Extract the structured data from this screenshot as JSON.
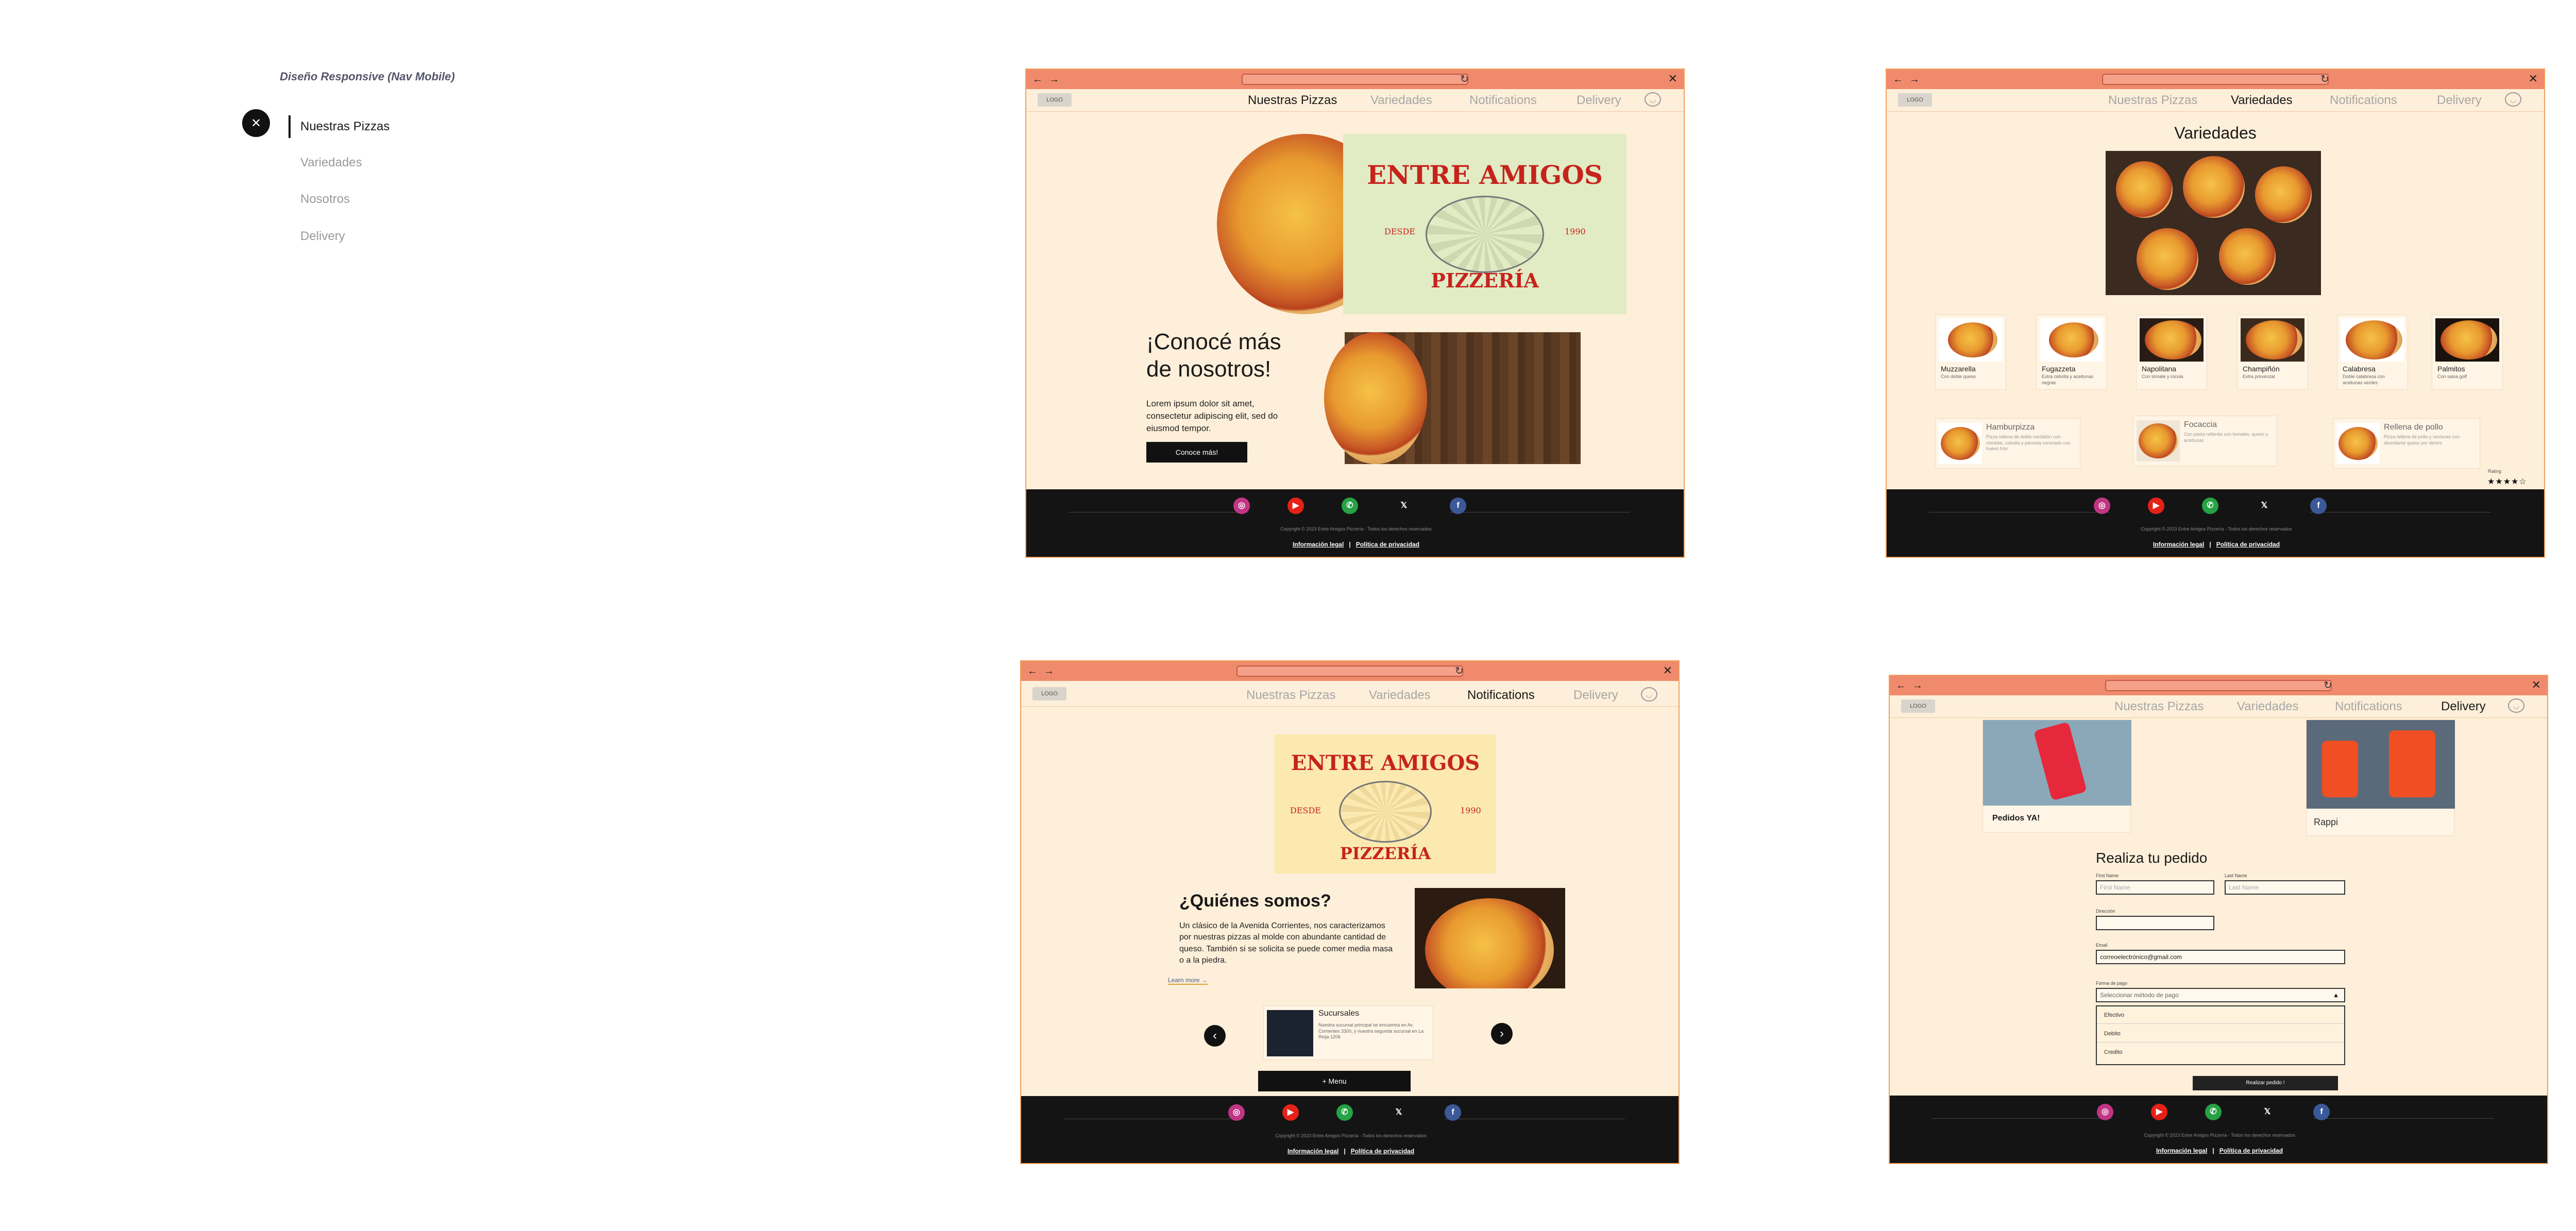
{
  "mobile_nav": {
    "heading": "Diseño Responsive (Nav Mobile)",
    "close_glyph": "✕",
    "items": [
      {
        "label": "Nuestras Pizzas"
      },
      {
        "label": "Variedades"
      },
      {
        "label": "Nosotros"
      },
      {
        "label": "Delivery"
      }
    ]
  },
  "browser": {
    "back": "←",
    "forward": "→",
    "reload": "↻",
    "close": "✕",
    "logo_label": "LOGO"
  },
  "nav": {
    "links": [
      "Nuestras Pizzas",
      "Variedades",
      "Notifications",
      "Delivery"
    ]
  },
  "footer": {
    "copyright": "Copyright © 2023 Entre Amigos Pizzería - Todos los derechos reservados",
    "legal": "Información legal",
    "separator": "|",
    "privacy": "Política de privacidad",
    "socials": [
      {
        "icon": "instagram-icon",
        "glyph": "◎",
        "color": "#c13584"
      },
      {
        "icon": "youtube-icon",
        "glyph": "▶",
        "color": "#e62117"
      },
      {
        "icon": "whatsapp-icon",
        "glyph": "✆",
        "color": "#25a244"
      },
      {
        "icon": "x-icon",
        "glyph": "𝕏",
        "color": "#141414"
      },
      {
        "icon": "facebook-icon",
        "glyph": "f",
        "color": "#3b5998"
      }
    ]
  },
  "brand": {
    "title": "ENTRE AMIGOS",
    "desde": "DESDE",
    "year": "1990",
    "pizzeria": "PIZZERÍA"
  },
  "screen1": {
    "about_title_1": "¡Conocé más",
    "about_title_2": "de nosotros!",
    "about_text": "Lorem ipsum dolor sit amet, consectetur adipiscing elit, sed do eiusmod tempor.",
    "cta": "Conoce más!"
  },
  "screen2": {
    "title": "Variedades",
    "pizzas": [
      {
        "name": "Muzzarella",
        "desc": "Con doble queso"
      },
      {
        "name": "Fugazzeta",
        "desc": "Extra cebolla y aceitunas negras"
      },
      {
        "name": "Napolitana",
        "desc": "Con tomate y rúcula"
      },
      {
        "name": "Champiñón",
        "desc": "Extra provenzal"
      },
      {
        "name": "Calabresa",
        "desc": "Doble calabresa con aceitunas verdes"
      },
      {
        "name": "Palmitos",
        "desc": "Con salsa golf"
      }
    ],
    "specials": [
      {
        "name": "Hamburpizza",
        "desc": "Pizza rellena de doble medallón con cheddar, cebolla y panceta coronado con huevo frito"
      },
      {
        "name": "Focaccia",
        "desc": "Con pasta rellenita con tomates, queso y aceitunas"
      },
      {
        "name": "Rellena de pollo",
        "desc": "Pizza rellena de pollo y verduras con abundante queso por dentro"
      }
    ],
    "rating_label": "Rating",
    "stars": "★★★★☆"
  },
  "screen3": {
    "title": "¿Quiénes somos?",
    "text": "Un clásico de la Avenida Corrientes, nos caracterizamos por nuestras pizzas al molde con abundante cantidad de queso. También si se solicita se puede comer media masa o a la piedra.",
    "learn_more": "Learn more →",
    "branch_title": "Sucursales",
    "branch_text": "Nuestra sucursal principal se encuentra en Av. Corrientes 3300, y nuestra segunda sucursal en La Rioja 1206",
    "prev": "‹",
    "next": "›",
    "menu_btn": "+ Menu"
  },
  "screen4": {
    "app1": "Pedidos YA!",
    "app2": "Rappi",
    "form_title": "Realiza tu pedido",
    "first_name_label": "First Name",
    "first_name_placeholder": "First Name",
    "last_name_label": "Last Name",
    "last_name_placeholder": "Last Name",
    "address_label": "Dirección",
    "email_label": "Email",
    "email_value": "correoelectrónico@gmail.com",
    "payment_label": "Forma de pago",
    "payment_placeholder": "Seleccionar método de pago",
    "payment_options": [
      "Efectivo",
      "Debito",
      "Credito"
    ],
    "submit": "Realizar pedido !"
  }
}
